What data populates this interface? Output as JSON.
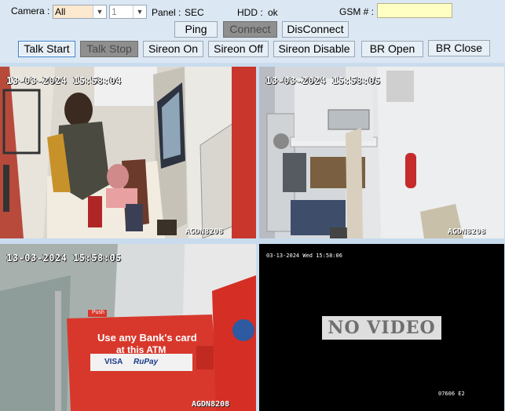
{
  "toolbar": {
    "camera_label": "Camera :",
    "camera_select_value": "All",
    "channel_select_value": "1",
    "panel_label": "Panel :",
    "panel_value": "SEC",
    "hdd_label": "HDD :",
    "hdd_value": "ok",
    "gsm_label": "GSM # :",
    "gsm_value": "",
    "ping_label": "Ping",
    "connect_label": "Connect",
    "disconnect_label": "DisConnect",
    "talk_start_label": "Talk Start",
    "talk_stop_label": "Talk Stop",
    "sireon_on_label": "Sireon On",
    "sireon_off_label": "Sireon Off",
    "sireon_disable_label": "Sireon Disable",
    "br_open_label": "BR Open",
    "br_close_label": "BR Close"
  },
  "feeds": [
    {
      "timestamp": "13-03-2024 15:58:04",
      "camera_id": "AGDN8208"
    },
    {
      "timestamp": "13-03-2024 15:58:05",
      "camera_id": "AGDN8208"
    },
    {
      "timestamp": "13-03-2024 15:58:05",
      "camera_id": "AGDN8208",
      "sign_line1": "Use any Bank's card",
      "sign_line2": "at this ATM",
      "sign_visa": "VISA",
      "sign_rupay": "RuPay",
      "push_label": "Push"
    },
    {
      "osd_top": "03-13-2024 Wed 15:58:06",
      "status": "NO VIDEO",
      "osd_bottom": "07606 E2"
    }
  ],
  "colors": {
    "toolbar_bg": "#dbe7f3",
    "gsm_field_bg": "#ffffc4",
    "camera_select_bg": "#fde9d0"
  }
}
